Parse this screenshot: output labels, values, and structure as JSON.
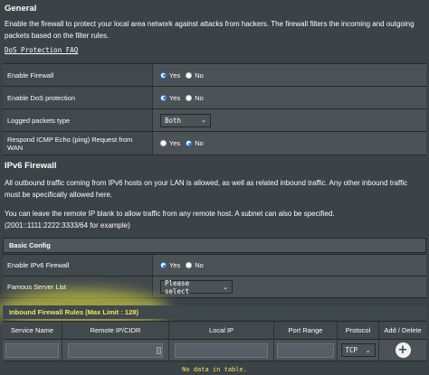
{
  "general": {
    "title": "General",
    "description": "Enable the firewall to protect your local area network against attacks from hackers. The firewall filters the incoming and outgoing packets based on the filter rules.",
    "faq_link": "DoS Protection FAQ",
    "rows": [
      {
        "label": "Enable Firewall",
        "yes": "Yes",
        "no": "No",
        "selected": "yes"
      },
      {
        "label": "Enable DoS protection",
        "yes": "Yes",
        "no": "No",
        "selected": "yes"
      },
      {
        "label": "Logged packets type",
        "select_value": "Both"
      },
      {
        "label": "Respond ICMP Echo (ping) Request from WAN",
        "yes": "Yes",
        "no": "No",
        "selected": "no"
      }
    ]
  },
  "ipv6": {
    "title": "IPv6 Firewall",
    "description": "All outbound traffic coming from IPv6 hosts on your LAN is allowed, as well as related inbound traffic. Any other inbound traffic must be specifically allowed here.",
    "note1": "You can leave the remote IP blank to allow traffic from any remote host. A subnet can also be specified.",
    "note2": "(2001::1111:2222:3333/64 for example)"
  },
  "basic_config": {
    "title": "Basic Config",
    "rows": [
      {
        "label": "Enable IPv6 Firewall",
        "yes": "Yes",
        "no": "No",
        "selected": "yes"
      },
      {
        "label": "Famous Server List",
        "select_value": "Please select"
      }
    ]
  },
  "inbound": {
    "title": "Inbound Firewall Rules (Max Limit : 128)",
    "columns": [
      "Service Name",
      "Remote IP/CIDR",
      "Local IP",
      "Port Range",
      "Protocol",
      "Add / Delete"
    ],
    "protocol_value": "TCP",
    "empty_text": "No data in table."
  },
  "icons": {
    "dropdown": "chevron-down-icon",
    "add": "plus-circle-icon",
    "remote_ip_picker": "list-picker-icon"
  },
  "colors": {
    "background": "#3b4347",
    "highlight_text": "#f7e75b",
    "radio_selected": "#2b7bd6"
  }
}
